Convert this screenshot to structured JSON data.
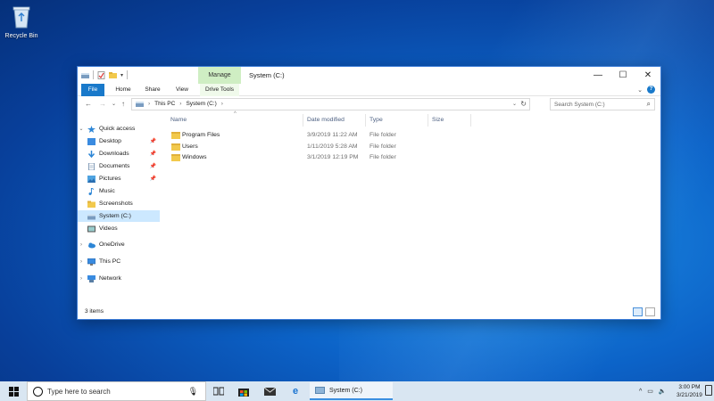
{
  "desktop": {
    "recycle_bin_label": "Recycle Bin"
  },
  "window": {
    "title": "System (C:)",
    "contextual_tab": "Manage",
    "controls": {
      "minimize": "—",
      "maximize": "☐",
      "close": "✕"
    }
  },
  "ribbon": {
    "tabs": [
      "File",
      "Home",
      "Share",
      "View",
      "Drive Tools"
    ],
    "help_label": "?"
  },
  "address": {
    "crumbs": [
      "This PC",
      "System (C:)"
    ],
    "search_placeholder": "Search System (C:)"
  },
  "navigation": {
    "items": [
      {
        "label": "Quick access",
        "pinned": false
      },
      {
        "label": "Desktop",
        "pinned": true
      },
      {
        "label": "Downloads",
        "pinned": true
      },
      {
        "label": "Documents",
        "pinned": true
      },
      {
        "label": "Pictures",
        "pinned": true
      },
      {
        "label": "Music",
        "pinned": false
      },
      {
        "label": "Screenshots",
        "pinned": false
      },
      {
        "label": "System (C:)",
        "pinned": false,
        "selected": true
      },
      {
        "label": "Videos",
        "pinned": false
      },
      {
        "label": "OneDrive",
        "pinned": false
      },
      {
        "label": "This PC",
        "pinned": false
      },
      {
        "label": "Network",
        "pinned": false
      }
    ]
  },
  "columns": [
    "Name",
    "Date modified",
    "Type",
    "Size"
  ],
  "files": [
    {
      "name": "Program Files",
      "date": "3/9/2019 11:22 AM",
      "type": "File folder"
    },
    {
      "name": "Users",
      "date": "1/11/2019 5:28 AM",
      "type": "File folder"
    },
    {
      "name": "Windows",
      "date": "3/1/2019 12:19 PM",
      "type": "File folder"
    }
  ],
  "status": {
    "item_count": "3 items"
  },
  "taskbar": {
    "search_placeholder": "Type here to search",
    "open_window": "System (C:)",
    "time": "3:00 PM",
    "date": "3/21/2019"
  },
  "colors": {
    "accent": "#1979ca",
    "selection": "#cce8ff",
    "manage_tab": "#cfeec3",
    "folder": "#f2c94c"
  }
}
